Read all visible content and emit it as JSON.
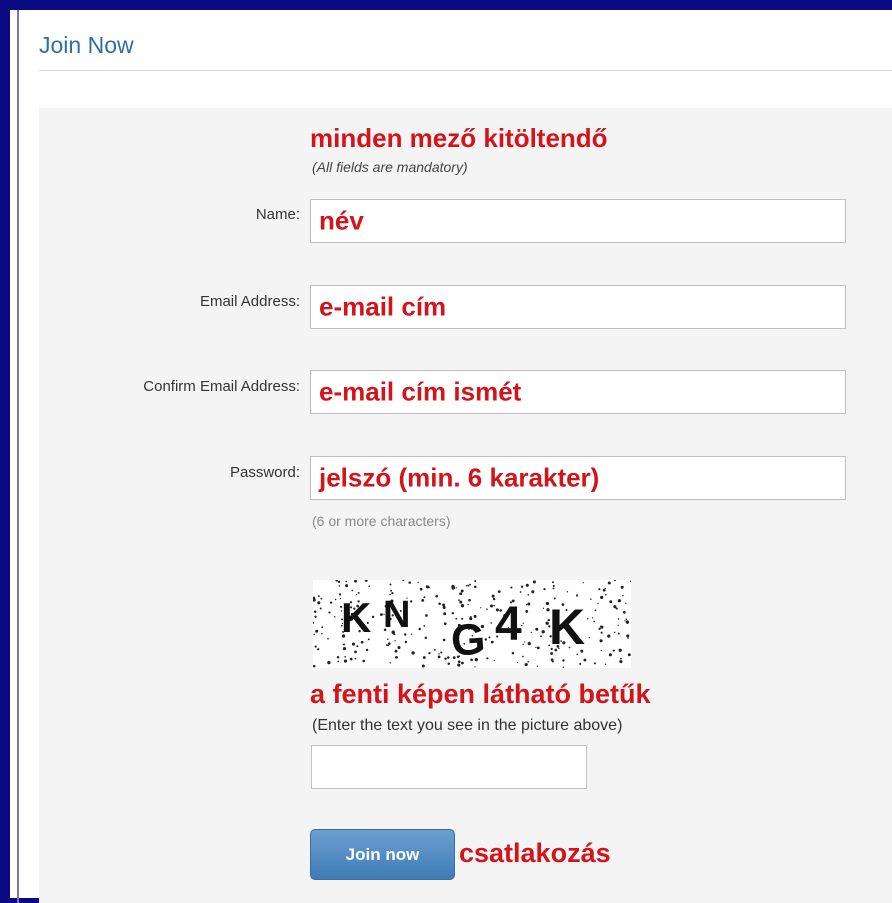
{
  "header": {
    "title": "Join Now"
  },
  "form": {
    "mandatory_note_hu": "minden mező kitöltendő",
    "mandatory_note_en": "(All fields are mandatory)",
    "fields": [
      {
        "label": "Name:",
        "annotation": "név"
      },
      {
        "label": "Email Address:",
        "annotation": "e-mail cím"
      },
      {
        "label": "Confirm Email Address:",
        "annotation": "e-mail cím ismét"
      },
      {
        "label": "Password:",
        "annotation": "jelszó (min. 6 karakter)"
      }
    ],
    "password_hint": "(6 or more characters)",
    "captcha": {
      "text": "KNG4K",
      "annotation_hu": "a fenti képen látható betűk",
      "instruction_en": "(Enter the text you see in the picture above)",
      "input_value": ""
    },
    "submit": {
      "label": "Join now",
      "annotation_hu": "csatlakozás"
    }
  },
  "colors": {
    "frame": "#0a0a82",
    "annotation": "#d4141b",
    "title": "#2e6fa7",
    "button": "#4a86c0",
    "panel": "#f4f4f4"
  }
}
